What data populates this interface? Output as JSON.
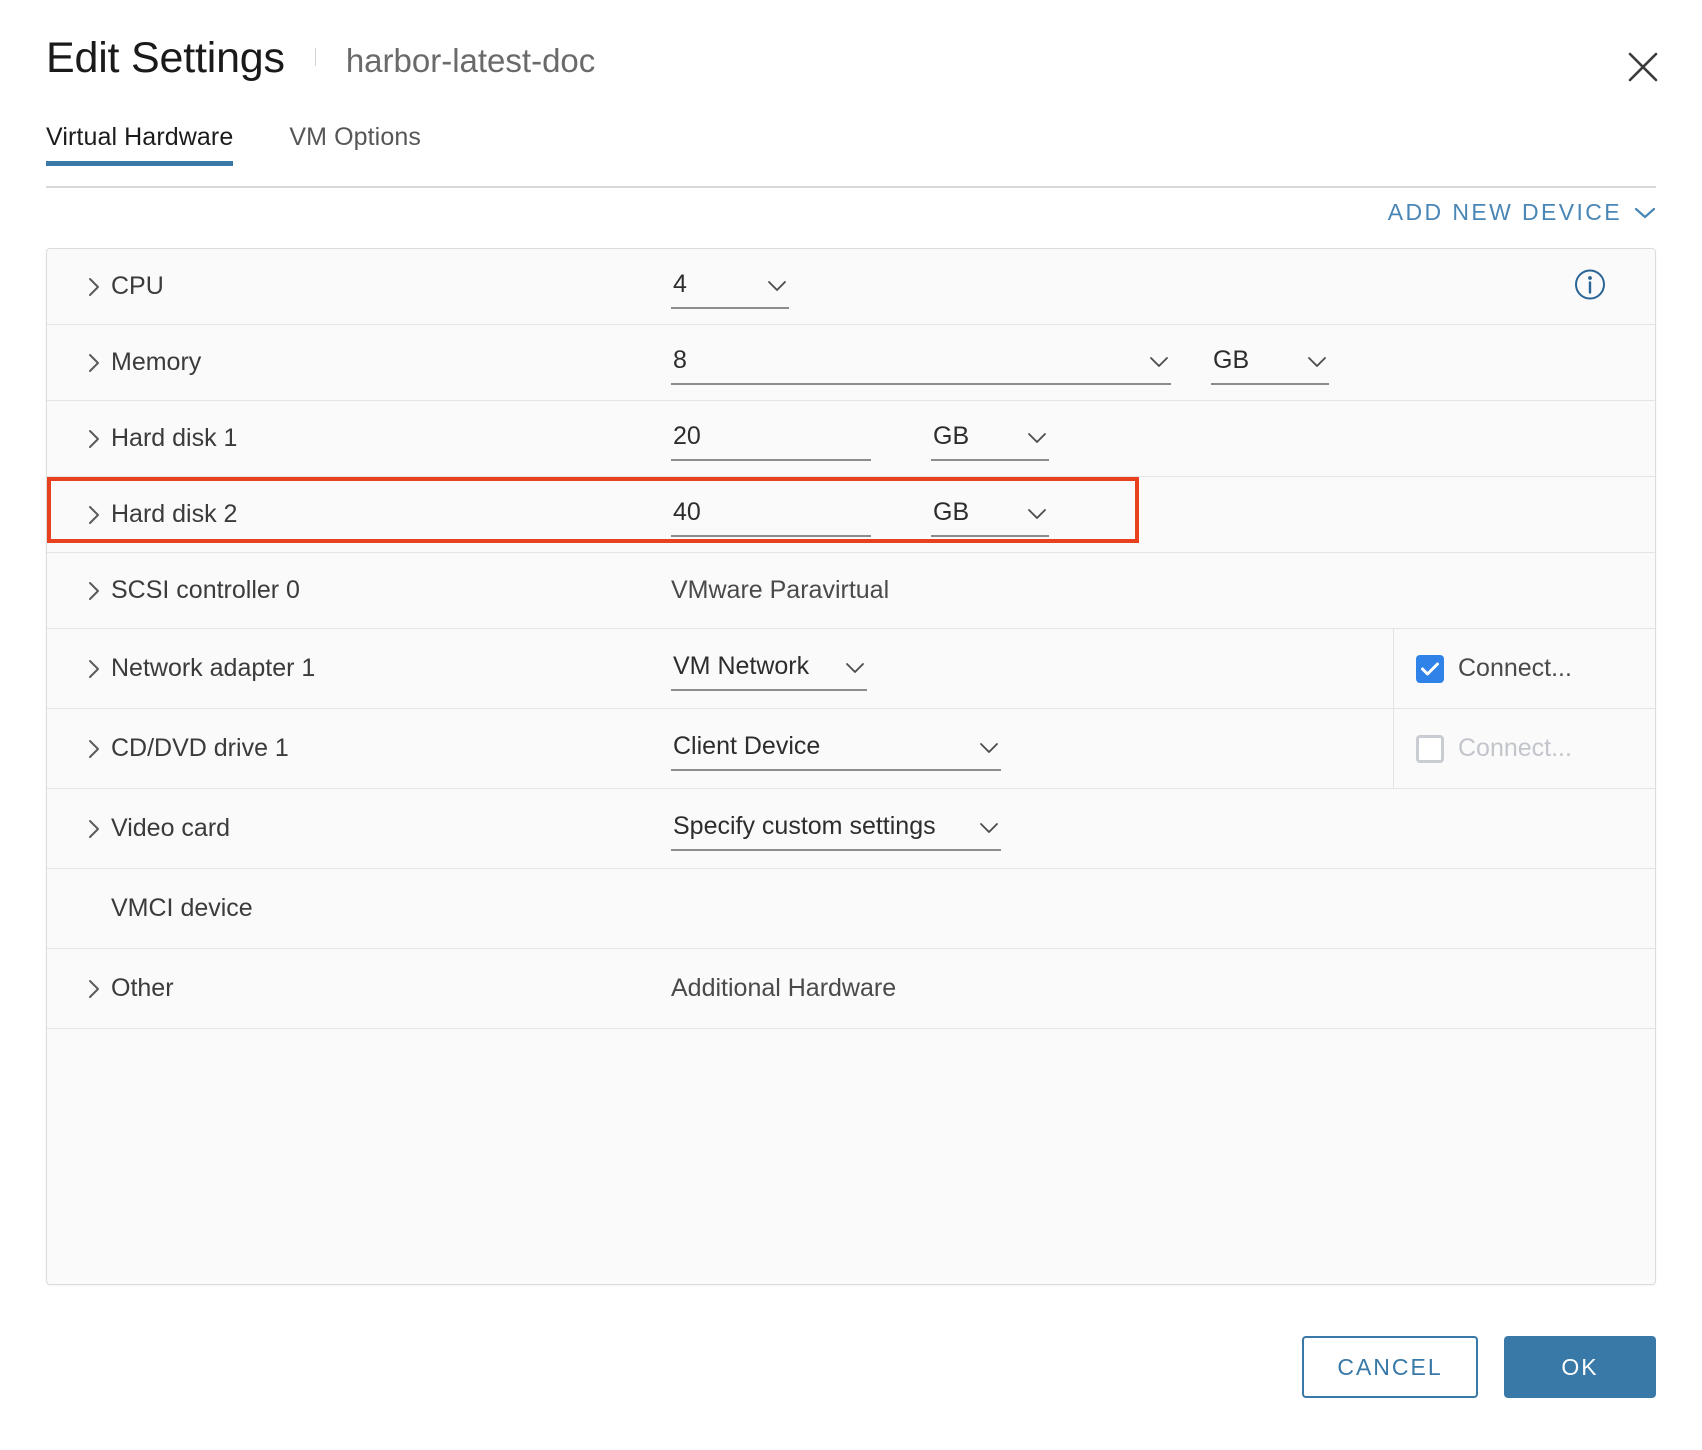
{
  "header": {
    "title": "Edit Settings",
    "vm_name": "harbor-latest-doc",
    "close_icon": "close-icon"
  },
  "tabs": [
    {
      "label": "Virtual Hardware",
      "active": true
    },
    {
      "label": "VM Options",
      "active": false
    }
  ],
  "toolbar": {
    "add_new_device_label": "ADD NEW DEVICE",
    "add_new_device_icon": "chevron-down-icon"
  },
  "colors": {
    "accent_blue": "#3879a8",
    "link_blue": "#4986b5",
    "checkbox_blue": "#2f83e8",
    "highlight_red": "#e8411f",
    "panel_bg": "#fafafa"
  },
  "devices": [
    {
      "label": "CPU",
      "expandable": true,
      "control": "select",
      "value": "4",
      "unit": null,
      "info_icon": "info-circle-icon",
      "connect": null
    },
    {
      "label": "Memory",
      "expandable": true,
      "control": "select",
      "value": "8",
      "unit": "GB",
      "info_icon": null,
      "connect": null
    },
    {
      "label": "Hard disk 1",
      "expandable": true,
      "control": "input",
      "value": "20",
      "unit": "GB",
      "info_icon": null,
      "connect": null
    },
    {
      "label": "Hard disk 2",
      "expandable": true,
      "control": "input",
      "value": "40",
      "unit": "GB",
      "info_icon": null,
      "connect": null,
      "highlighted": true
    },
    {
      "label": "SCSI controller 0",
      "expandable": true,
      "control": "text",
      "value": "VMware Paravirtual",
      "unit": null,
      "info_icon": null,
      "connect": null
    },
    {
      "label": "Network adapter 1",
      "expandable": true,
      "control": "select",
      "value": "VM Network",
      "unit": null,
      "info_icon": null,
      "connect": {
        "label": "Connect...",
        "checked": true,
        "disabled": false
      }
    },
    {
      "label": "CD/DVD drive 1",
      "expandable": true,
      "control": "select",
      "value": "Client Device",
      "unit": null,
      "info_icon": null,
      "connect": {
        "label": "Connect...",
        "checked": false,
        "disabled": true
      }
    },
    {
      "label": "Video card",
      "expandable": true,
      "control": "select",
      "value": "Specify custom settings",
      "unit": null,
      "info_icon": null,
      "connect": null
    },
    {
      "label": "VMCI device",
      "expandable": false,
      "control": "none",
      "value": "",
      "unit": null,
      "info_icon": null,
      "connect": null
    },
    {
      "label": "Other",
      "expandable": true,
      "control": "text",
      "value": "Additional Hardware",
      "unit": null,
      "info_icon": null,
      "connect": null
    }
  ],
  "footer": {
    "cancel_label": "CANCEL",
    "ok_label": "OK"
  }
}
